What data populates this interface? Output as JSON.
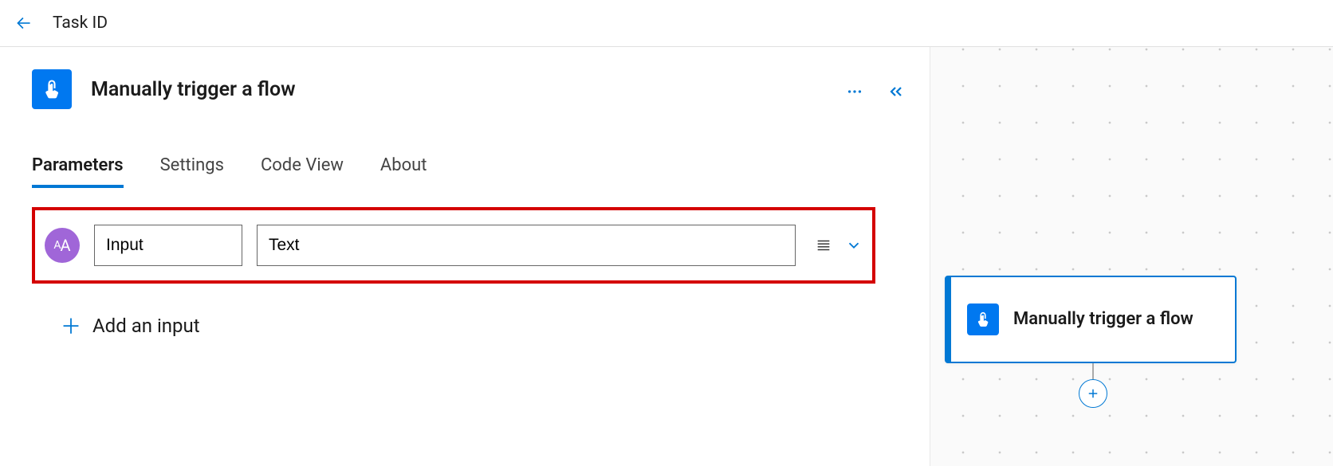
{
  "topbar": {
    "title": "Task ID"
  },
  "panel": {
    "title": "Manually trigger a flow"
  },
  "tabs": {
    "parameters": "Parameters",
    "settings": "Settings",
    "codeview": "Code View",
    "about": "About"
  },
  "input_row": {
    "name_value": "Input",
    "text_value": "Text"
  },
  "add_input_label": "Add an input",
  "canvas": {
    "card_title": "Manually trigger a flow"
  }
}
